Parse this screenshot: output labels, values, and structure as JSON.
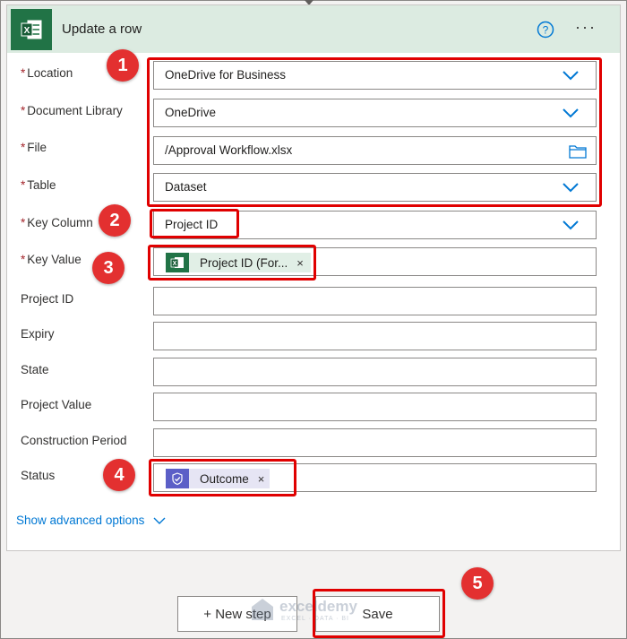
{
  "header": {
    "title": "Update a row",
    "help_icon": "question-circle-icon",
    "more_icon": "ellipsis-icon",
    "more_glyph": "···",
    "accent": "#217346"
  },
  "required_marker": "*",
  "fields": {
    "location": {
      "label": "Location",
      "value": "OneDrive for Business"
    },
    "document_library": {
      "label": "Document Library",
      "value": "OneDrive"
    },
    "file": {
      "label": "File",
      "value": "/Approval Workflow.xlsx"
    },
    "table": {
      "label": "Table",
      "value": "Dataset"
    },
    "key_column": {
      "label": "Key Column",
      "value": "Project ID"
    },
    "key_value": {
      "label": "Key Value",
      "token": "Project ID (For...",
      "token_remove": "×"
    },
    "project_id": {
      "label": "Project ID",
      "value": ""
    },
    "expiry": {
      "label": "Expiry",
      "value": ""
    },
    "state": {
      "label": "State",
      "value": ""
    },
    "project_value": {
      "label": "Project Value",
      "value": ""
    },
    "construction_period": {
      "label": "Construction Period",
      "value": ""
    },
    "status": {
      "label": "Status",
      "token": "Outcome",
      "token_remove": "×"
    }
  },
  "advanced": {
    "label": "Show advanced options"
  },
  "buttons": {
    "new_step": "+ New step",
    "save": "Save"
  },
  "annotations": {
    "n1": "1",
    "n2": "2",
    "n3": "3",
    "n4": "4",
    "n5": "5",
    "color": "#e33030"
  },
  "watermark": {
    "main": "exceldemy",
    "sub": "EXCEL · DATA · BI"
  }
}
